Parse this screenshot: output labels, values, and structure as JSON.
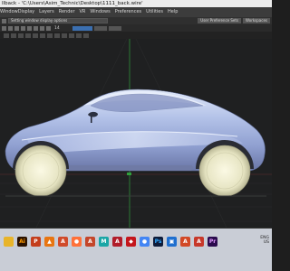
{
  "window": {
    "title": "Ilback - 'C:\\Users\\Asim_Technic\\Desktop\\1111_back.wire'"
  },
  "menu": {
    "items": [
      "WindowDisplay",
      "Layers",
      "Render",
      "VR",
      "Windows",
      "Preferences",
      "Utilities",
      "Help"
    ]
  },
  "toolbar": {
    "field_text": "Setting window display options",
    "user_prefs_label": "User Preference Sets",
    "workspace_label": "Workspaces",
    "value": "14"
  },
  "viewport": {
    "background": "#1f2021",
    "car_color": "#b7c6ea",
    "tire_color": "#e6e4c2"
  },
  "taskbar": {
    "tray_line1": "ENG",
    "tray_line2": "US",
    "icons": [
      {
        "name": "folder",
        "label": "",
        "color": "#e8b42a"
      },
      {
        "name": "illustrator",
        "label": "Ai",
        "color": "#2b1200"
      },
      {
        "name": "powerpoint",
        "label": "P",
        "color": "#c43e1c"
      },
      {
        "name": "vlc",
        "label": "▲",
        "color": "#e87511"
      },
      {
        "name": "autodesk-a",
        "label": "A",
        "color": "#d04a2a"
      },
      {
        "name": "firefox",
        "label": "●",
        "color": "#ff7139"
      },
      {
        "name": "autodesk-a2",
        "label": "A",
        "color": "#c4462a"
      },
      {
        "name": "maya",
        "label": "M",
        "color": "#1aa6a6"
      },
      {
        "name": "autocad",
        "label": "A",
        "color": "#b11c2a"
      },
      {
        "name": "red-app",
        "label": "◆",
        "color": "#c4161c"
      },
      {
        "name": "chrome",
        "label": "●",
        "color": "#4285f4"
      },
      {
        "name": "photoshop",
        "label": "Ps",
        "color": "#0e1c3a"
      },
      {
        "name": "photos",
        "label": "▣",
        "color": "#1f6fcf"
      },
      {
        "name": "autodesk-3",
        "label": "A",
        "color": "#d24826"
      },
      {
        "name": "alias",
        "label": "A",
        "color": "#c7382a"
      },
      {
        "name": "premiere",
        "label": "Pr",
        "color": "#2a0a4d"
      }
    ]
  }
}
